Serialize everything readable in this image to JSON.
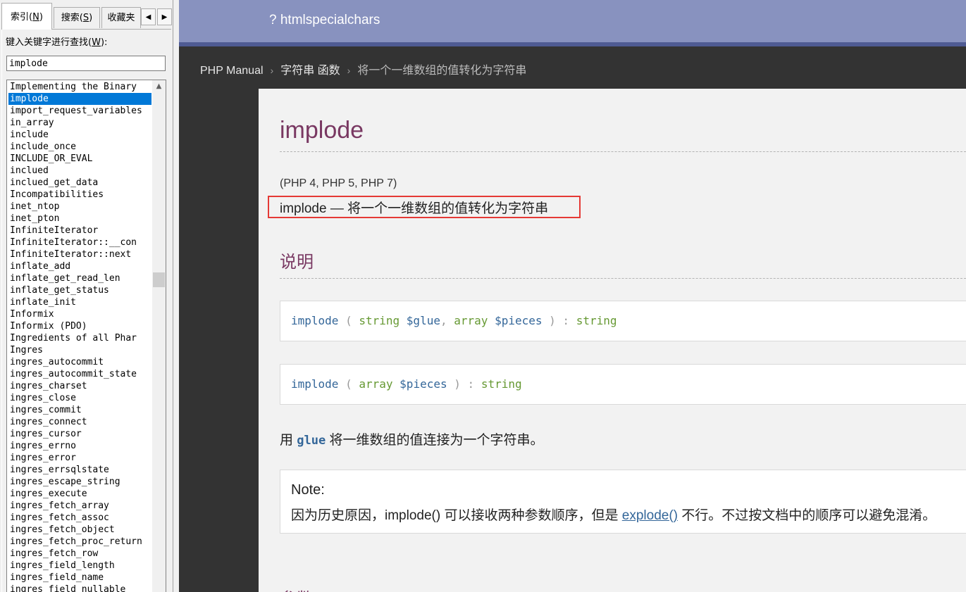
{
  "left": {
    "tabs": {
      "index_label": "索引(",
      "index_key": "N",
      "index_end": ")",
      "search_label": "搜索(",
      "search_key": "S",
      "search_end": ")",
      "fav_label": "收藏夹"
    },
    "keyword_label_pre": "键入关键字进行查找(",
    "keyword_label_key": "W",
    "keyword_label_post": "):",
    "keyword_value": "implode",
    "items": [
      "Implementing the Binary",
      "implode",
      "import_request_variables",
      "in_array",
      "include",
      "include_once",
      "INCLUDE_OR_EVAL",
      "inclued",
      "inclued_get_data",
      "Incompatibilities",
      "inet_ntop",
      "inet_pton",
      "InfiniteIterator",
      "InfiniteIterator::__con",
      "InfiniteIterator::next",
      "inflate_add",
      "inflate_get_read_len",
      "inflate_get_status",
      "inflate_init",
      "Informix",
      "Informix (PDO)",
      "Ingredients of all Phar",
      "Ingres",
      "ingres_autocommit",
      "ingres_autocommit_state",
      "ingres_charset",
      "ingres_close",
      "ingres_commit",
      "ingres_connect",
      "ingres_cursor",
      "ingres_errno",
      "ingres_error",
      "ingres_errsqlstate",
      "ingres_escape_string",
      "ingres_execute",
      "ingres_fetch_array",
      "ingres_fetch_assoc",
      "ingres_fetch_object",
      "ingres_fetch_proc_return",
      "ingres_fetch_row",
      "ingres_field_length",
      "ingres_field_name",
      "ingres_field_nullable"
    ],
    "selected_item": "implode"
  },
  "topbar": {
    "title": "? htmlspecialchars"
  },
  "breadcrumb": {
    "items": [
      "PHP Manual",
      "字符串 函数"
    ],
    "current": "将一个一维数组的值转化为字符串",
    "separator": "›"
  },
  "doc": {
    "title": "implode",
    "version": "(PHP 4, PHP 5, PHP 7)",
    "refpurpose": "implode — 将一个一维数组的值转化为字符串",
    "description_heading": "说明",
    "synopsis1": {
      "name": "implode",
      "open": "(",
      "t1": "string",
      "v1": "$glue",
      "comma": ",",
      "t2": "array",
      "v2": "$pieces",
      "close": ")",
      "colon": ":",
      "ret": "string"
    },
    "synopsis2": {
      "name": "implode",
      "open": "(",
      "t1": "array",
      "v1": "$pieces",
      "close": ")",
      "colon": ":",
      "ret": "string"
    },
    "desc_pre": "用",
    "desc_code": "glue",
    "desc_post": "将一维数组的值连接为一个字符串。",
    "note_title": "Note:",
    "note_pre": "因为历史原因，implode() 可以接收两种参数顺序，但是",
    "note_link": "explode()",
    "note_post": "不行。不过按文档中的顺序可以避免混淆。",
    "params_heading": "参数"
  },
  "colors": {
    "topbar": "#8892bf",
    "topbar_line": "#4f5b93",
    "heading": "#793862",
    "highlight_box": "#e53935",
    "selection": "#0078d7"
  }
}
